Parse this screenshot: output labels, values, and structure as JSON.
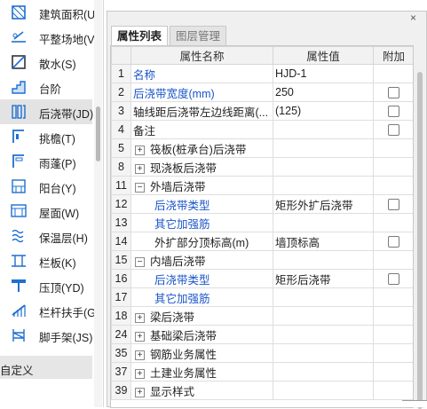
{
  "sidebar": {
    "items": [
      {
        "label": "建筑面积(U",
        "icon": "building-area-icon"
      },
      {
        "label": "平整场地(V",
        "icon": "site-leveling-icon"
      },
      {
        "label": "散水(S)",
        "icon": "apron-icon"
      },
      {
        "label": "台阶",
        "icon": "steps-icon"
      },
      {
        "label": "后浇带(JD)",
        "icon": "post-cast-strip-icon"
      },
      {
        "label": "挑檐(T)",
        "icon": "cornice-icon"
      },
      {
        "label": "雨蓬(P)",
        "icon": "canopy-icon"
      },
      {
        "label": "阳台(Y)",
        "icon": "balcony-icon"
      },
      {
        "label": "屋面(W)",
        "icon": "roof-icon"
      },
      {
        "label": "保温层(H)",
        "icon": "insulation-icon"
      },
      {
        "label": "栏板(K)",
        "icon": "parapet-icon"
      },
      {
        "label": "压顶(YD)",
        "icon": "coping-icon"
      },
      {
        "label": "栏杆扶手(G",
        "icon": "railing-icon"
      },
      {
        "label": "脚手架(JS)",
        "icon": "scaffold-icon"
      }
    ],
    "footer_label": "自定义"
  },
  "panel": {
    "close_symbol": "×",
    "tabs": [
      {
        "label": "属性列表",
        "active": true
      },
      {
        "label": "图层管理",
        "active": false
      }
    ],
    "columns": {
      "num": "",
      "name": "属性名称",
      "value": "属性值",
      "add": "附加"
    },
    "rows": [
      {
        "num": "1",
        "name": "名称",
        "value": "HJD-1",
        "checkbox": false,
        "expander": "",
        "blue": true,
        "indent": 0
      },
      {
        "num": "2",
        "name": "后浇带宽度(mm)",
        "value": "250",
        "checkbox": true,
        "expander": "",
        "blue": true,
        "indent": 0
      },
      {
        "num": "3",
        "name": "轴线距后浇带左边线距离(...",
        "value": "(125)",
        "checkbox": true,
        "expander": "",
        "blue": false,
        "indent": 0
      },
      {
        "num": "4",
        "name": "备注",
        "value": "",
        "checkbox": true,
        "expander": "",
        "blue": false,
        "indent": 0
      },
      {
        "num": "5",
        "name": "筏板(桩承台)后浇带",
        "value": "",
        "checkbox": false,
        "expander": "+",
        "blue": false,
        "indent": 0
      },
      {
        "num": "8",
        "name": "现浇板后浇带",
        "value": "",
        "checkbox": false,
        "expander": "+",
        "blue": false,
        "indent": 0
      },
      {
        "num": "11",
        "name": "外墙后浇带",
        "value": "",
        "checkbox": false,
        "expander": "−",
        "blue": false,
        "indent": 0
      },
      {
        "num": "12",
        "name": "后浇带类型",
        "value": "矩形外扩后浇带",
        "checkbox": true,
        "expander": "",
        "blue": true,
        "indent": 1
      },
      {
        "num": "13",
        "name": "其它加强筋",
        "value": "",
        "checkbox": false,
        "expander": "",
        "blue": true,
        "indent": 1
      },
      {
        "num": "14",
        "name": "外扩部分顶标高(m)",
        "value": "墙顶标高",
        "checkbox": true,
        "expander": "",
        "blue": false,
        "indent": 1
      },
      {
        "num": "15",
        "name": "内墙后浇带",
        "value": "",
        "checkbox": false,
        "expander": "−",
        "blue": false,
        "indent": 0
      },
      {
        "num": "16",
        "name": "后浇带类型",
        "value": "矩形后浇带",
        "checkbox": true,
        "expander": "",
        "blue": true,
        "indent": 1
      },
      {
        "num": "17",
        "name": "其它加强筋",
        "value": "",
        "checkbox": false,
        "expander": "",
        "blue": true,
        "indent": 1
      },
      {
        "num": "18",
        "name": "梁后浇带",
        "value": "",
        "checkbox": false,
        "expander": "+",
        "blue": false,
        "indent": 0
      },
      {
        "num": "24",
        "name": "基础梁后浇带",
        "value": "",
        "checkbox": false,
        "expander": "+",
        "blue": false,
        "indent": 0
      },
      {
        "num": "35",
        "name": "钢筋业务属性",
        "value": "",
        "checkbox": false,
        "expander": "+",
        "blue": false,
        "indent": 0
      },
      {
        "num": "37",
        "name": "土建业务属性",
        "value": "",
        "checkbox": false,
        "expander": "+",
        "blue": false,
        "indent": 0
      },
      {
        "num": "39",
        "name": "显示样式",
        "value": "",
        "checkbox": false,
        "expander": "+",
        "blue": false,
        "indent": 0
      }
    ]
  },
  "colors": {
    "accent_blue": "#1a55c9",
    "active_side_bg": "#e3e3e3"
  }
}
